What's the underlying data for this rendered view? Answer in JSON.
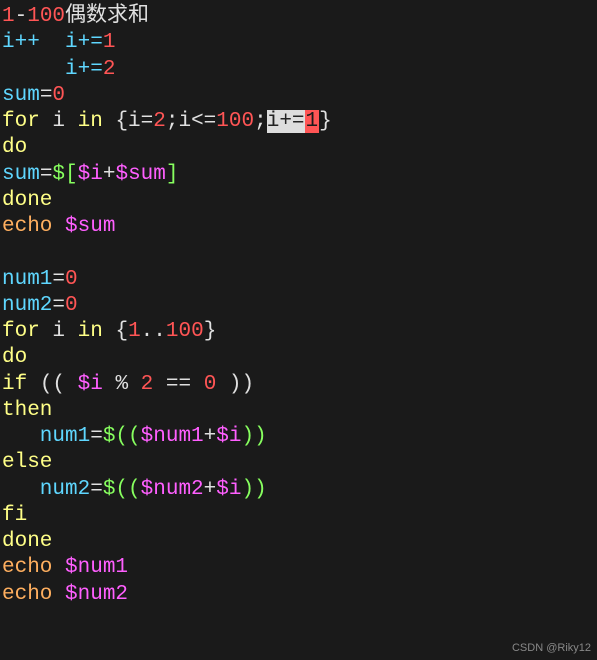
{
  "code": {
    "l1_a": "1",
    "l1_b": "-",
    "l1_c": "100",
    "l1_d": "偶数求和",
    "l2_a": "i++  i+=",
    "l2_b": "1",
    "l3_a": "     i+=",
    "l3_b": "2",
    "l4_a": "sum",
    "l4_b": "=",
    "l4_c": "0",
    "l5_a": "for",
    "l5_b": " i ",
    "l5_c": "in",
    "l5_d": " {i=",
    "l5_e": "2",
    "l5_f": ";i<=",
    "l5_g": "100",
    "l5_h": ";",
    "l5_i": "i+=",
    "l5_cursor": "1",
    "l5_j": "}",
    "l6_a": "do",
    "l7_a": "sum",
    "l7_b": "=",
    "l7_c": "$[",
    "l7_d": "$i",
    "l7_e": "+",
    "l7_f": "$sum",
    "l7_g": "]",
    "l8_a": "done",
    "l9_a": "echo",
    "l9_b": " $sum",
    "l11_a": "num1",
    "l11_b": "=",
    "l11_c": "0",
    "l12_a": "num2",
    "l12_b": "=",
    "l12_c": "0",
    "l13_a": "for",
    "l13_b": " i ",
    "l13_c": "in",
    "l13_d": " {",
    "l13_e": "1",
    "l13_f": "..",
    "l13_g": "100",
    "l13_h": "}",
    "l14_a": "do",
    "l15_a": "if",
    "l15_b": " (( ",
    "l15_c": "$i",
    "l15_d": " % ",
    "l15_e": "2",
    "l15_f": " == ",
    "l15_g": "0",
    "l15_h": " ))",
    "l16_a": "then",
    "l17_a": "   num1",
    "l17_b": "=",
    "l17_c": "$((",
    "l17_d": "$num1",
    "l17_e": "+",
    "l17_f": "$i",
    "l17_g": "))",
    "l18_a": "else",
    "l19_a": "   num2",
    "l19_b": "=",
    "l19_c": "$((",
    "l19_d": "$num2",
    "l19_e": "+",
    "l19_f": "$i",
    "l19_g": "))",
    "l20_a": "fi",
    "l21_a": "done",
    "l22_a": "echo",
    "l22_b": " $num1",
    "l23_a": "echo",
    "l23_b": " $num2"
  },
  "watermark": "CSDN @Riky12"
}
